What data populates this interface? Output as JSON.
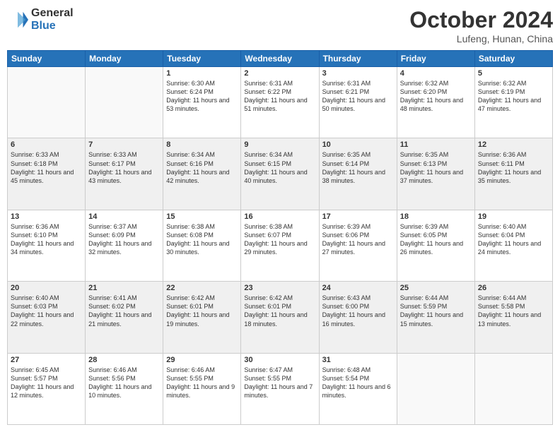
{
  "header": {
    "logo_line1": "General",
    "logo_line2": "Blue",
    "month": "October 2024",
    "location": "Lufeng, Hunan, China"
  },
  "weekdays": [
    "Sunday",
    "Monday",
    "Tuesday",
    "Wednesday",
    "Thursday",
    "Friday",
    "Saturday"
  ],
  "rows": [
    [
      {
        "day": "",
        "text": ""
      },
      {
        "day": "",
        "text": ""
      },
      {
        "day": "1",
        "text": "Sunrise: 6:30 AM\nSunset: 6:24 PM\nDaylight: 11 hours and 53 minutes."
      },
      {
        "day": "2",
        "text": "Sunrise: 6:31 AM\nSunset: 6:22 PM\nDaylight: 11 hours and 51 minutes."
      },
      {
        "day": "3",
        "text": "Sunrise: 6:31 AM\nSunset: 6:21 PM\nDaylight: 11 hours and 50 minutes."
      },
      {
        "day": "4",
        "text": "Sunrise: 6:32 AM\nSunset: 6:20 PM\nDaylight: 11 hours and 48 minutes."
      },
      {
        "day": "5",
        "text": "Sunrise: 6:32 AM\nSunset: 6:19 PM\nDaylight: 11 hours and 47 minutes."
      }
    ],
    [
      {
        "day": "6",
        "text": "Sunrise: 6:33 AM\nSunset: 6:18 PM\nDaylight: 11 hours and 45 minutes."
      },
      {
        "day": "7",
        "text": "Sunrise: 6:33 AM\nSunset: 6:17 PM\nDaylight: 11 hours and 43 minutes."
      },
      {
        "day": "8",
        "text": "Sunrise: 6:34 AM\nSunset: 6:16 PM\nDaylight: 11 hours and 42 minutes."
      },
      {
        "day": "9",
        "text": "Sunrise: 6:34 AM\nSunset: 6:15 PM\nDaylight: 11 hours and 40 minutes."
      },
      {
        "day": "10",
        "text": "Sunrise: 6:35 AM\nSunset: 6:14 PM\nDaylight: 11 hours and 38 minutes."
      },
      {
        "day": "11",
        "text": "Sunrise: 6:35 AM\nSunset: 6:13 PM\nDaylight: 11 hours and 37 minutes."
      },
      {
        "day": "12",
        "text": "Sunrise: 6:36 AM\nSunset: 6:11 PM\nDaylight: 11 hours and 35 minutes."
      }
    ],
    [
      {
        "day": "13",
        "text": "Sunrise: 6:36 AM\nSunset: 6:10 PM\nDaylight: 11 hours and 34 minutes."
      },
      {
        "day": "14",
        "text": "Sunrise: 6:37 AM\nSunset: 6:09 PM\nDaylight: 11 hours and 32 minutes."
      },
      {
        "day": "15",
        "text": "Sunrise: 6:38 AM\nSunset: 6:08 PM\nDaylight: 11 hours and 30 minutes."
      },
      {
        "day": "16",
        "text": "Sunrise: 6:38 AM\nSunset: 6:07 PM\nDaylight: 11 hours and 29 minutes."
      },
      {
        "day": "17",
        "text": "Sunrise: 6:39 AM\nSunset: 6:06 PM\nDaylight: 11 hours and 27 minutes."
      },
      {
        "day": "18",
        "text": "Sunrise: 6:39 AM\nSunset: 6:05 PM\nDaylight: 11 hours and 26 minutes."
      },
      {
        "day": "19",
        "text": "Sunrise: 6:40 AM\nSunset: 6:04 PM\nDaylight: 11 hours and 24 minutes."
      }
    ],
    [
      {
        "day": "20",
        "text": "Sunrise: 6:40 AM\nSunset: 6:03 PM\nDaylight: 11 hours and 22 minutes."
      },
      {
        "day": "21",
        "text": "Sunrise: 6:41 AM\nSunset: 6:02 PM\nDaylight: 11 hours and 21 minutes."
      },
      {
        "day": "22",
        "text": "Sunrise: 6:42 AM\nSunset: 6:01 PM\nDaylight: 11 hours and 19 minutes."
      },
      {
        "day": "23",
        "text": "Sunrise: 6:42 AM\nSunset: 6:01 PM\nDaylight: 11 hours and 18 minutes."
      },
      {
        "day": "24",
        "text": "Sunrise: 6:43 AM\nSunset: 6:00 PM\nDaylight: 11 hours and 16 minutes."
      },
      {
        "day": "25",
        "text": "Sunrise: 6:44 AM\nSunset: 5:59 PM\nDaylight: 11 hours and 15 minutes."
      },
      {
        "day": "26",
        "text": "Sunrise: 6:44 AM\nSunset: 5:58 PM\nDaylight: 11 hours and 13 minutes."
      }
    ],
    [
      {
        "day": "27",
        "text": "Sunrise: 6:45 AM\nSunset: 5:57 PM\nDaylight: 11 hours and 12 minutes."
      },
      {
        "day": "28",
        "text": "Sunrise: 6:46 AM\nSunset: 5:56 PM\nDaylight: 11 hours and 10 minutes."
      },
      {
        "day": "29",
        "text": "Sunrise: 6:46 AM\nSunset: 5:55 PM\nDaylight: 11 hours and 9 minutes."
      },
      {
        "day": "30",
        "text": "Sunrise: 6:47 AM\nSunset: 5:55 PM\nDaylight: 11 hours and 7 minutes."
      },
      {
        "day": "31",
        "text": "Sunrise: 6:48 AM\nSunset: 5:54 PM\nDaylight: 11 hours and 6 minutes."
      },
      {
        "day": "",
        "text": ""
      },
      {
        "day": "",
        "text": ""
      }
    ]
  ]
}
